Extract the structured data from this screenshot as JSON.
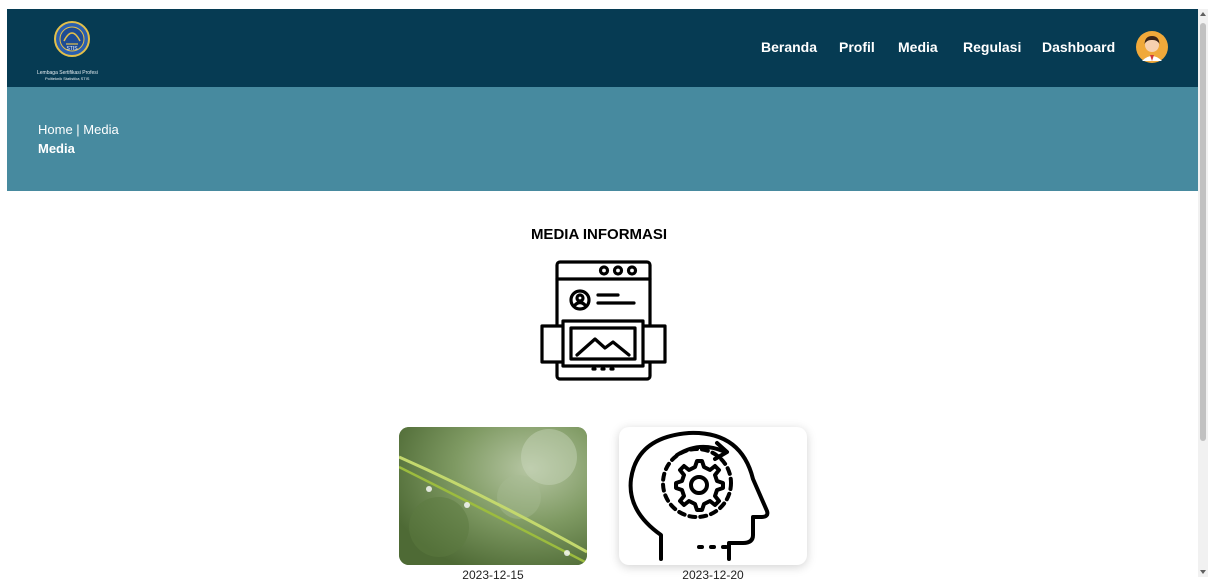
{
  "navbar": {
    "logo_line1": "Lembaga Sertifikasi Profesi",
    "logo_line2": "Politeknik Statistika STIS",
    "logo_badge": "STIS",
    "items": [
      {
        "label": "Beranda"
      },
      {
        "label": "Profil"
      },
      {
        "label": "Media"
      },
      {
        "label": "Regulasi"
      },
      {
        "label": "Dashboard"
      }
    ],
    "avatar_icon": "user-avatar-icon"
  },
  "banner": {
    "breadcrumb": "Home | Media",
    "title": "Media"
  },
  "main": {
    "section_title": "MEDIA INFORMASI",
    "section_icon": "media-website-icon",
    "cards": [
      {
        "date": "2023-12-15",
        "image": "grass-dew-drops-photo"
      },
      {
        "date": "2023-12-20",
        "image": "head-gear-icon"
      }
    ]
  },
  "colors": {
    "navbar_bg": "#063b53",
    "banner_bg": "#478a9f",
    "text_on_dark": "#ffffff"
  }
}
